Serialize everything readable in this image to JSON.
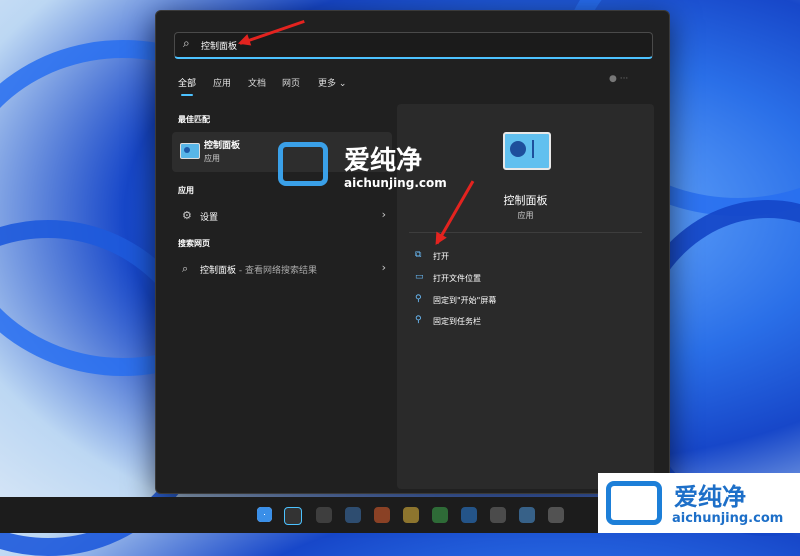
{
  "search": {
    "value": "控制面板"
  },
  "tabs": [
    {
      "label": "全部"
    },
    {
      "label": "应用"
    },
    {
      "label": "文档"
    },
    {
      "label": "网页"
    },
    {
      "label": "更多 ⌄"
    }
  ],
  "tabs_right": "● ···",
  "left": {
    "best_match_heading": "最佳匹配",
    "best_match": {
      "title": "控制面板",
      "subtitle": "应用"
    },
    "apps_heading": "应用",
    "settings_label": "设置",
    "web_heading": "搜索网页",
    "web_query": "控制面板",
    "web_sub": " - 查看网络搜索结果"
  },
  "right": {
    "app_name": "控制面板",
    "app_type": "应用",
    "actions": [
      {
        "label": "打开",
        "icon": "open-icon"
      },
      {
        "label": "打开文件位置",
        "icon": "folder-icon"
      },
      {
        "label": "固定到\"开始\"屏幕",
        "icon": "pin-icon"
      },
      {
        "label": "固定到任务栏",
        "icon": "pin-icon"
      }
    ]
  },
  "watermark": {
    "cn": "爱纯净",
    "url": "aichunjing.com"
  },
  "colors": {
    "accent": "#4cc2ff",
    "arrow": "#e3231f",
    "panel": "#202020"
  }
}
